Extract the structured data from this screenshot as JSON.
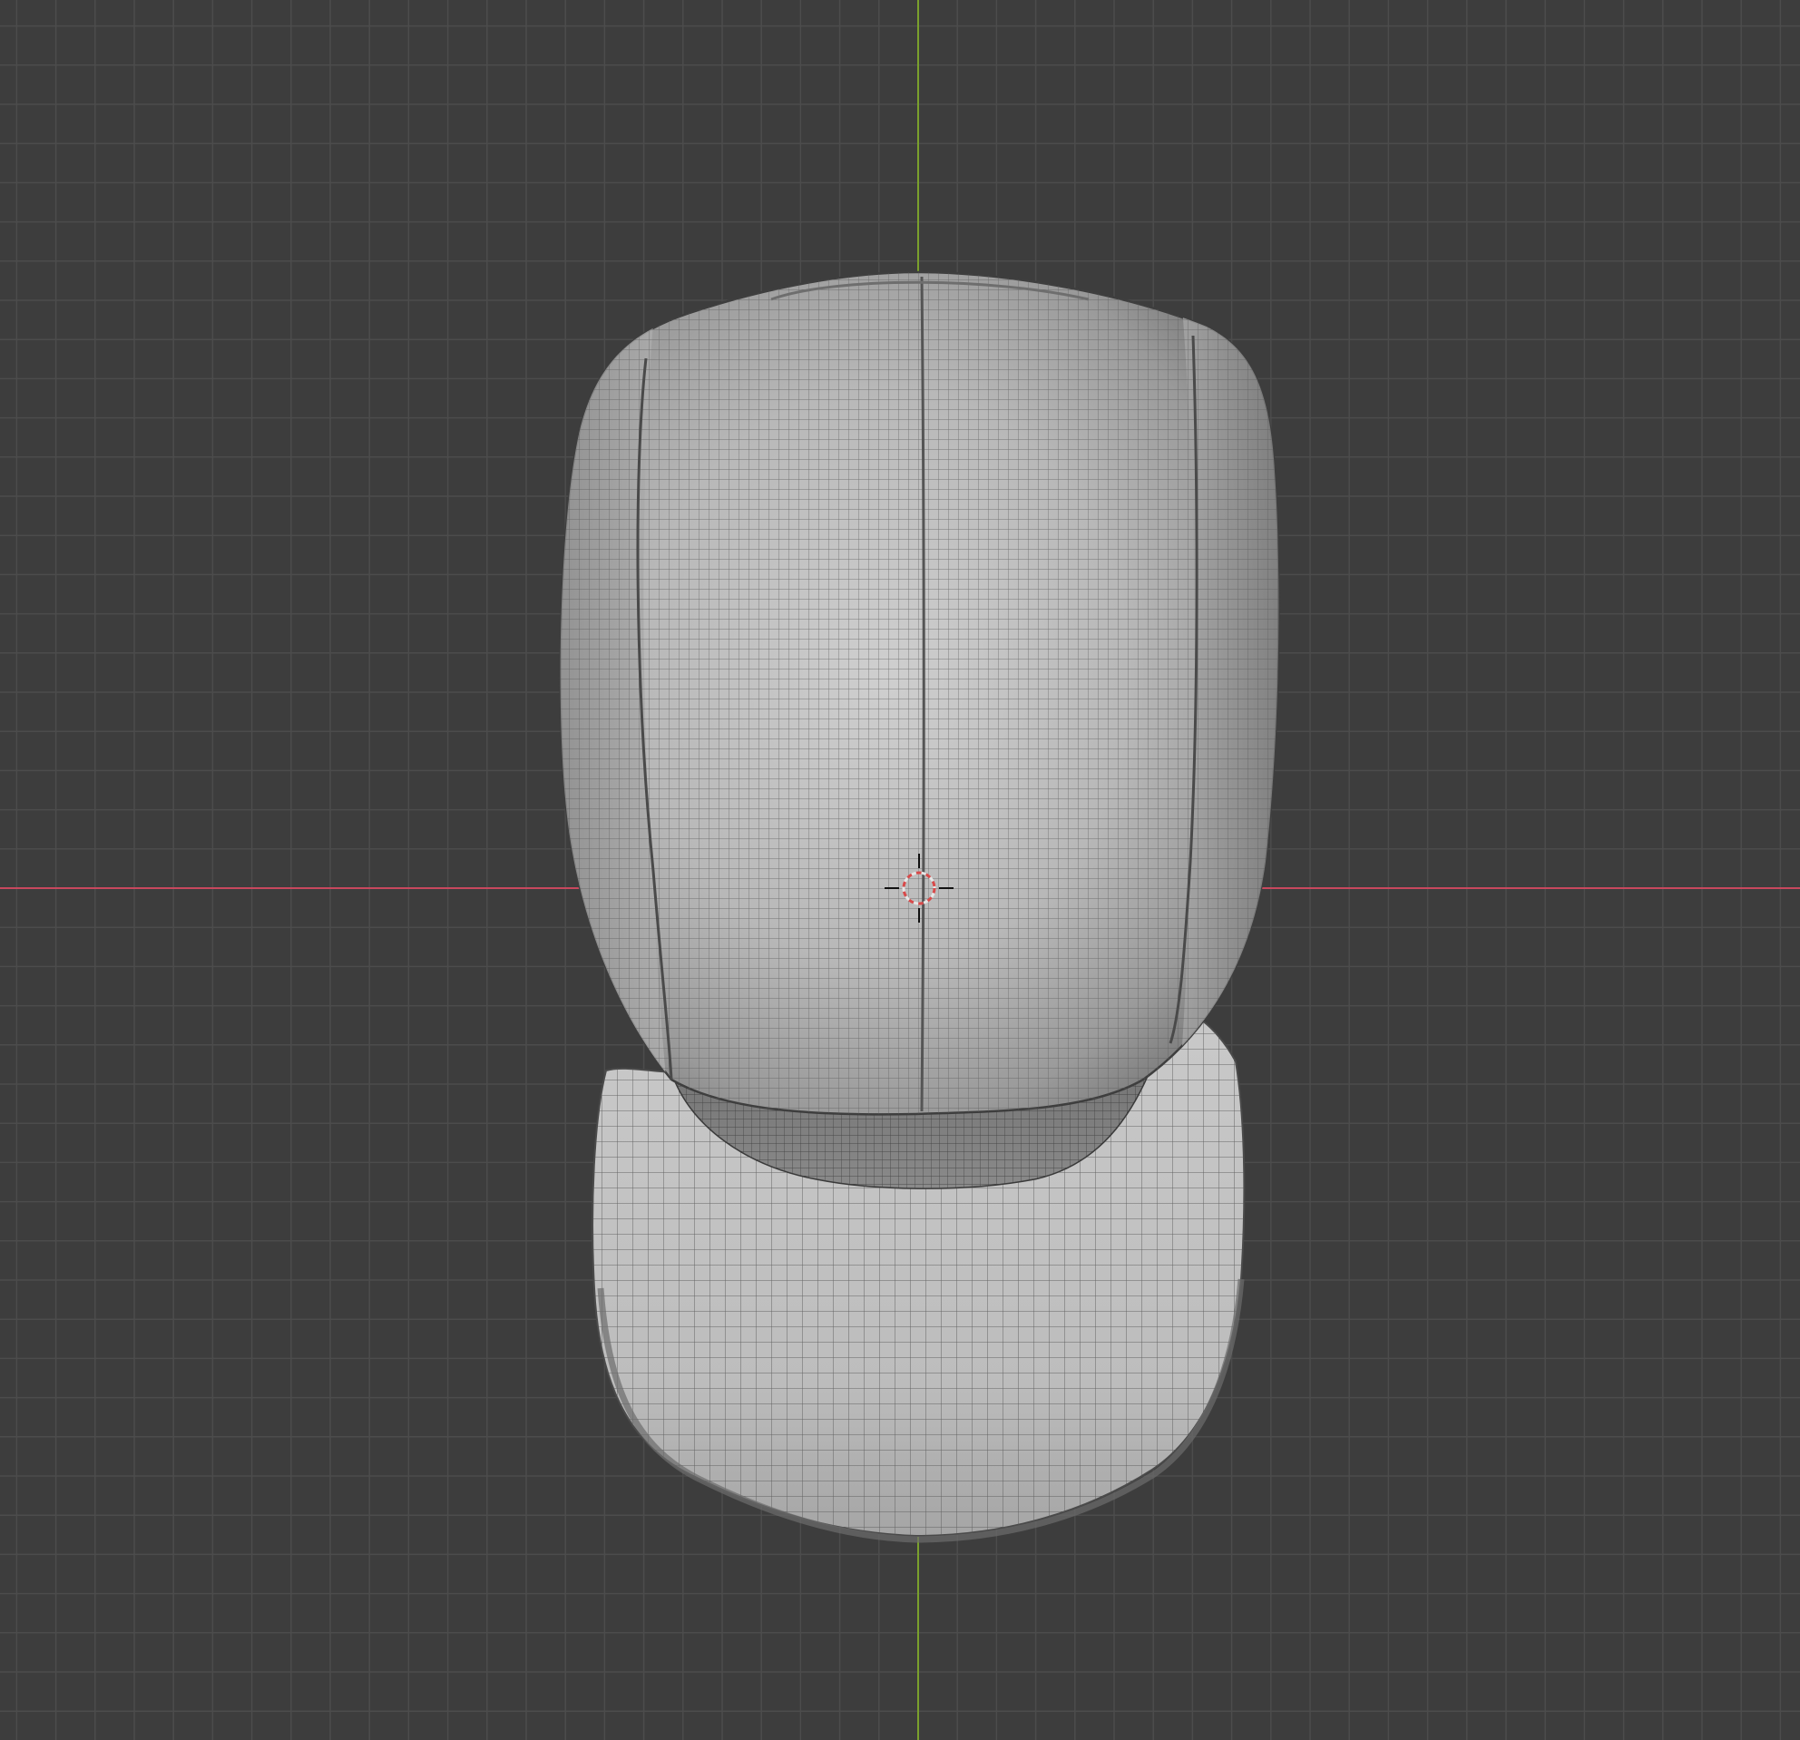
{
  "viewport": {
    "view": "top-orthographic",
    "object": "baseball-cap-mesh",
    "shading": "solid-wireframe-overlay",
    "show_grid": true,
    "show_x_axis": true,
    "show_y_axis": true,
    "show_3d_cursor": true
  },
  "colors": {
    "background": "#3d3d3d",
    "grid_line": "#4c4c4c",
    "x_axis": "#c8485e",
    "y_axis": "#7aa02d",
    "mesh_light": "#c4c4c4",
    "mesh_mid": "#a8a8a8",
    "mesh_dark": "#5e5e5e",
    "wire": "#5a5a5a",
    "cursor_red": "#d84a4a",
    "cursor_white": "#e6e6e6"
  },
  "icons": {
    "cursor": "3d-cursor-icon"
  }
}
